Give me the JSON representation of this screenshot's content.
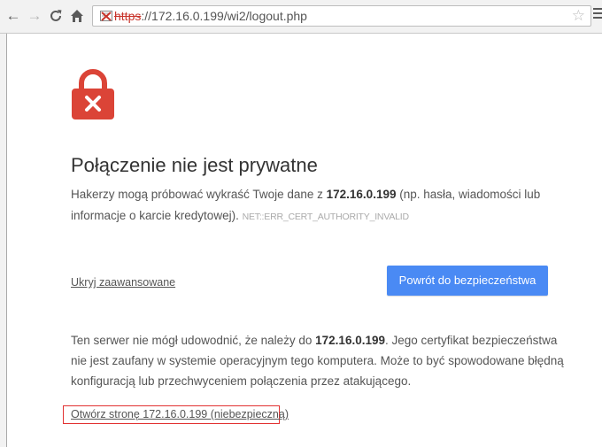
{
  "browser": {
    "url_scheme": "https",
    "url_rest": "://172.16.0.199/wi2/logout.php",
    "icons": {
      "back": "back-arrow-icon",
      "forward": "forward-arrow-icon",
      "reload": "reload-icon",
      "home": "home-icon",
      "cert_error": "certificate-error-icon",
      "bookmark": "star-icon",
      "menu": "menu-icon"
    }
  },
  "interstitial": {
    "icon": "red-lock-x-icon",
    "heading": "Połączenie nie jest prywatne",
    "desc_pre": "Hakerzy mogą próbować wykraść Twoje dane z ",
    "desc_host": "172.16.0.199",
    "desc_post": " (np. hasła, wiadomości lub informacje o karcie kredytowej).",
    "error_code": "NET::ERR_CERT_AUTHORITY_INVALID",
    "advanced_link": "Ukryj zaawansowane",
    "back_button": "Powrót do bezpieczeństwa",
    "details_pre": "Ten serwer nie mógł udowodnić, że należy do ",
    "details_host": "172.16.0.199",
    "details_post": ". Jego certyfikat bezpieczeństwa nie jest zaufany w systemie operacyjnym tego komputera. Może to być spowodowane błędną konfiguracją lub przechwyceniem połączenia przez atakującego.",
    "proceed_link": "Otwórz stronę 172.16.0.199 (niebezpieczną)"
  },
  "colors": {
    "lock_red": "#db4437",
    "button_blue": "#4a8af4",
    "highlight_box": "#e23232",
    "text": "#555555"
  }
}
